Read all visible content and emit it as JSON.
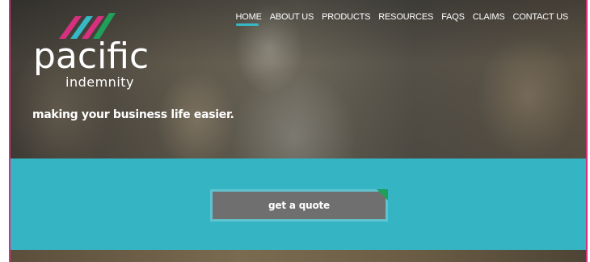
{
  "logo": {
    "word": "pacific",
    "sub": "indemnity",
    "stripe_colors": [
      "#d6307f",
      "#36b8c6",
      "#d6307f",
      "#1fa05a"
    ]
  },
  "nav": {
    "items": [
      {
        "label": "HOME",
        "active": true
      },
      {
        "label": "ABOUT US",
        "active": false
      },
      {
        "label": "PRODUCTS",
        "active": false
      },
      {
        "label": "RESOURCES",
        "active": false
      },
      {
        "label": "FAQS",
        "active": false
      },
      {
        "label": "CLAIMS",
        "active": false
      },
      {
        "label": "CONTACT US",
        "active": false
      }
    ]
  },
  "hero": {
    "tagline": "making your business life easier."
  },
  "cta": {
    "label": "get a quote"
  },
  "colors": {
    "accent_teal": "#35b5c4",
    "accent_magenta": "#d6307f",
    "accent_green": "#1fa05a",
    "button_gray": "#6f6f6f"
  }
}
